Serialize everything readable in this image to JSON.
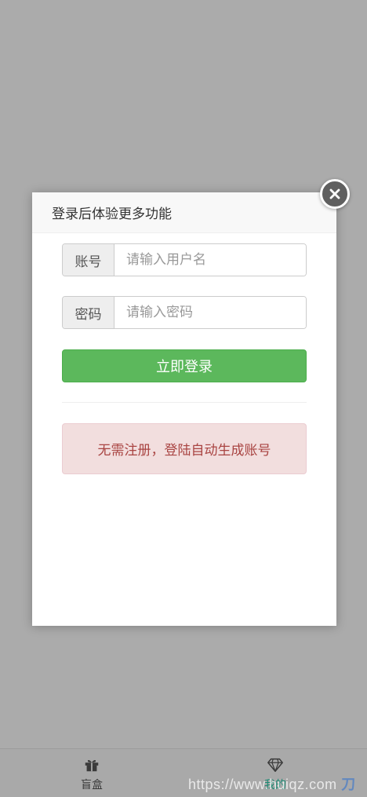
{
  "modal": {
    "title": "登录后体验更多功能",
    "username": {
      "label": "账号",
      "placeholder": "请输入用户名",
      "value": ""
    },
    "password": {
      "label": "密码",
      "placeholder": "请输入密码",
      "value": ""
    },
    "login_label": "立即登录",
    "notice": "无需注册，登陆自动生成账号"
  },
  "tabbar": {
    "items": [
      {
        "label": "盲盒",
        "icon": "gift-icon",
        "active": false
      },
      {
        "label": "我的",
        "icon": "diamond-icon",
        "active": true
      }
    ]
  },
  "watermark": {
    "url": "https://www.huiqz.com",
    "brand": "刀客源码网"
  },
  "colors": {
    "primary_green": "#5cb85c",
    "danger_bg": "#f2dede",
    "danger_text": "#a94442",
    "active_tab": "#1c8a73",
    "backdrop": "#ababab"
  }
}
